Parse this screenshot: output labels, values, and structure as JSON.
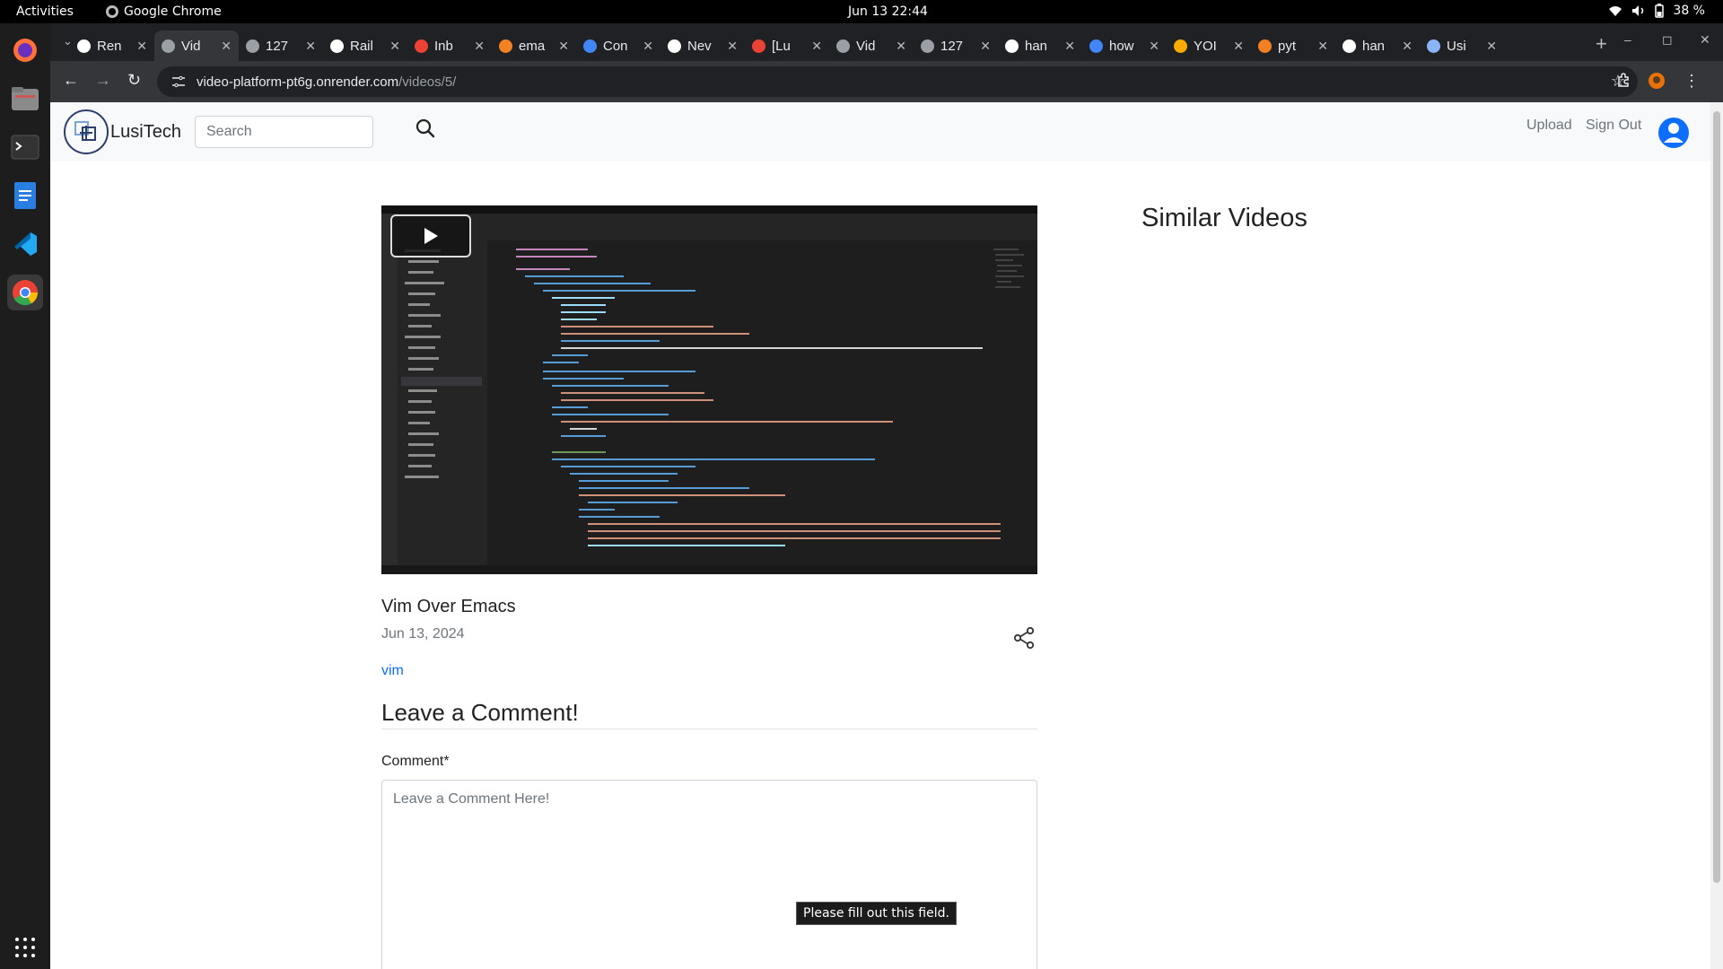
{
  "system_bar": {
    "activities": "Activities",
    "app_name": "Google Chrome",
    "clock": "Jun 13  22:44",
    "battery": "38 %"
  },
  "dock": {
    "items": [
      "firefox-icon",
      "files-icon",
      "terminal-icon",
      "text-editor-icon",
      "vscode-icon",
      "chrome-icon",
      "app-grid-icon"
    ]
  },
  "browser": {
    "tabs": [
      {
        "title": "Ren",
        "favicon_color": "#ffffff"
      },
      {
        "title": "Vid",
        "favicon_color": "#9aa0a6",
        "active": true
      },
      {
        "title": "127",
        "favicon_color": "#9aa0a6"
      },
      {
        "title": "Rail",
        "favicon_color": "#ffffff"
      },
      {
        "title": "Inb",
        "favicon_color": "#ea4335"
      },
      {
        "title": "ema",
        "favicon_color": "#f48024"
      },
      {
        "title": "Con",
        "favicon_color": "#4285f4"
      },
      {
        "title": "Nev",
        "favicon_color": "#ffffff"
      },
      {
        "title": "[Lu",
        "favicon_color": "#ea4335"
      },
      {
        "title": "Vid",
        "favicon_color": "#9aa0a6"
      },
      {
        "title": "127",
        "favicon_color": "#9aa0a6"
      },
      {
        "title": "han",
        "favicon_color": "#ffffff"
      },
      {
        "title": "how",
        "favicon_color": "#4285f4"
      },
      {
        "title": "YOI",
        "favicon_color": "#f9ab00"
      },
      {
        "title": "pyt",
        "favicon_color": "#f48024"
      },
      {
        "title": "han",
        "favicon_color": "#ffffff"
      },
      {
        "title": "Usi",
        "favicon_color": "#8ab4f8"
      }
    ],
    "url_host": "video-platform-pt6g.onrender.com",
    "url_path": "/videos/5/"
  },
  "site": {
    "brand": "LusiTech",
    "search_placeholder": "Search",
    "upload": "Upload",
    "sign_out": "Sign Out"
  },
  "video": {
    "title": "Vim Over Emacs",
    "date": "Jun 13, 2024",
    "tag": "vim"
  },
  "comments": {
    "heading": "Leave a Comment!",
    "label": "Comment*",
    "placeholder": "Leave a Comment Here!",
    "validation_tooltip": "Please fill out this field."
  },
  "sidebar": {
    "heading": "Similar Videos"
  }
}
